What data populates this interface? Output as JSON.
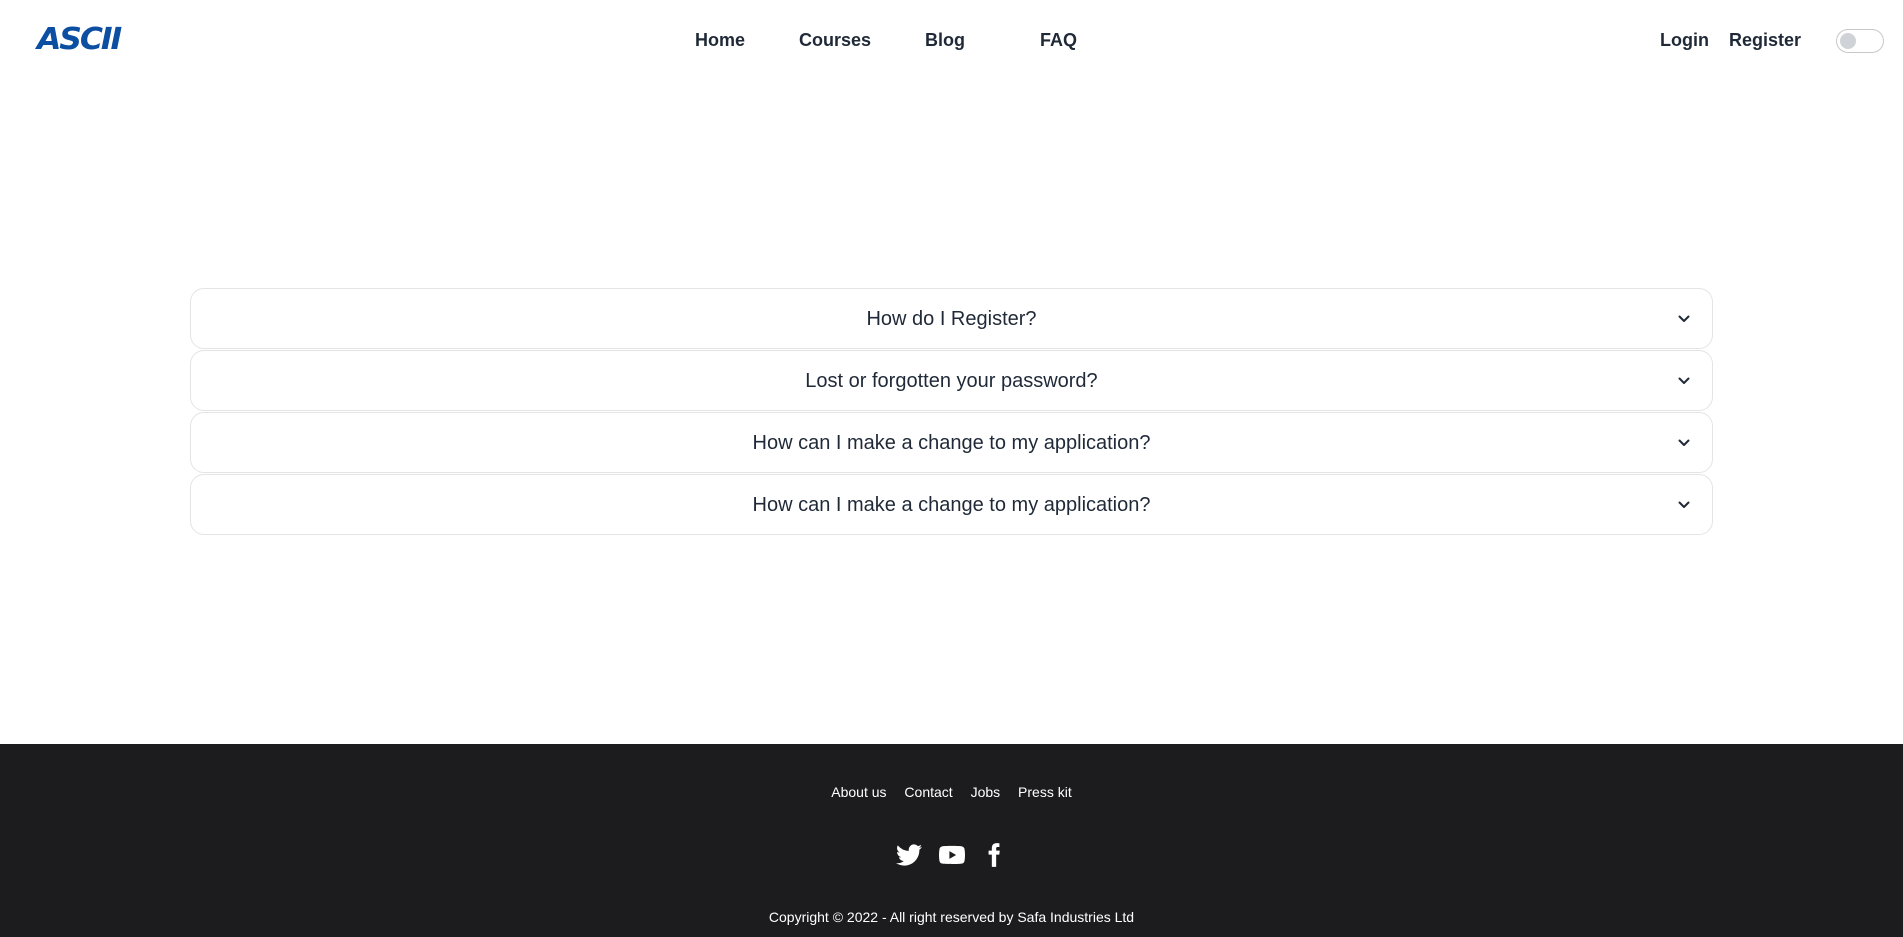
{
  "brand": {
    "logo_text": "ASCII",
    "color": "#0b4ea2"
  },
  "nav": {
    "links": [
      {
        "label": "Home"
      },
      {
        "label": "Courses"
      },
      {
        "label": "Blog"
      },
      {
        "label": "FAQ"
      }
    ],
    "auth": {
      "login": "Login",
      "register": "Register"
    },
    "theme_toggle": {
      "icon": "theme-toggle",
      "state": "off"
    }
  },
  "faq": {
    "items": [
      {
        "question": "How do I Register?",
        "icon": "chevron-down-icon"
      },
      {
        "question": "Lost or forgotten your password?",
        "icon": "chevron-down-icon"
      },
      {
        "question": "How can I make a change to my application?",
        "icon": "chevron-down-icon"
      },
      {
        "question": "How can I make a change to my application?",
        "icon": "chevron-down-icon"
      }
    ]
  },
  "footer": {
    "links": [
      "About us",
      "Contact",
      "Jobs",
      "Press kit"
    ],
    "social": [
      "twitter-icon",
      "youtube-icon",
      "facebook-icon"
    ],
    "copyright": "Copyright © 2022 - All right reserved by Safa Industries Ltd",
    "background": "#1c1c1e"
  }
}
